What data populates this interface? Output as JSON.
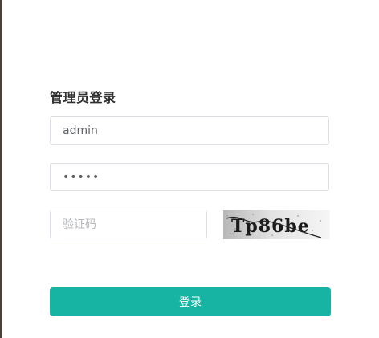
{
  "form": {
    "title": "管理员登录",
    "username_value": "admin",
    "password_mask": "•••••",
    "captcha_placeholder": "验证码",
    "captcha_text": "Tp86be",
    "login_label": "登录"
  },
  "colors": {
    "accent": "#17b3a3",
    "border": "#dcdfe6",
    "placeholder": "#b5b7bb"
  }
}
